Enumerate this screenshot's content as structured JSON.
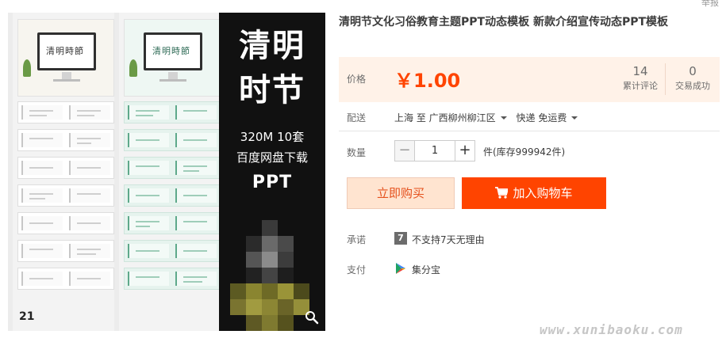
{
  "header": {
    "report_link": "举报"
  },
  "product": {
    "title": "清明节文化习俗教育主题PPT动态模板 新款介绍宣传动态PPT模板"
  },
  "gallery": {
    "slide_count": "21",
    "cover_left_title": "清明時節",
    "cover_right_title": "清明時節",
    "banner": {
      "line1": "清明",
      "line2": "时节",
      "line3": "320M  10套",
      "line4": "百度网盘下载",
      "line5": "PPT"
    }
  },
  "price_box": {
    "label": "价格",
    "price": "￥1.00",
    "reviews": {
      "count": "14",
      "label": "累计评论"
    },
    "deals": {
      "count": "0",
      "label": "交易成功"
    }
  },
  "shipping": {
    "label": "配送",
    "from": "上海 至",
    "to": "广西柳州柳江区",
    "method": "快递 免运费"
  },
  "quantity": {
    "label": "数量",
    "value": "1",
    "minus": "−",
    "plus": "+",
    "stock": "件(库存999942件)"
  },
  "actions": {
    "buy_now": "立即购买",
    "add_to_cart": "加入购物车"
  },
  "promise": {
    "label": "承诺",
    "icon_text": "7",
    "text": "不支持7天无理由"
  },
  "payment": {
    "label": "支付",
    "method": "集分宝"
  },
  "watermark": "www.xunibaoku.com",
  "colors": {
    "accent": "#ff4400",
    "price_bg": "#fff2e8",
    "buy_bg": "#ffe4d0"
  }
}
